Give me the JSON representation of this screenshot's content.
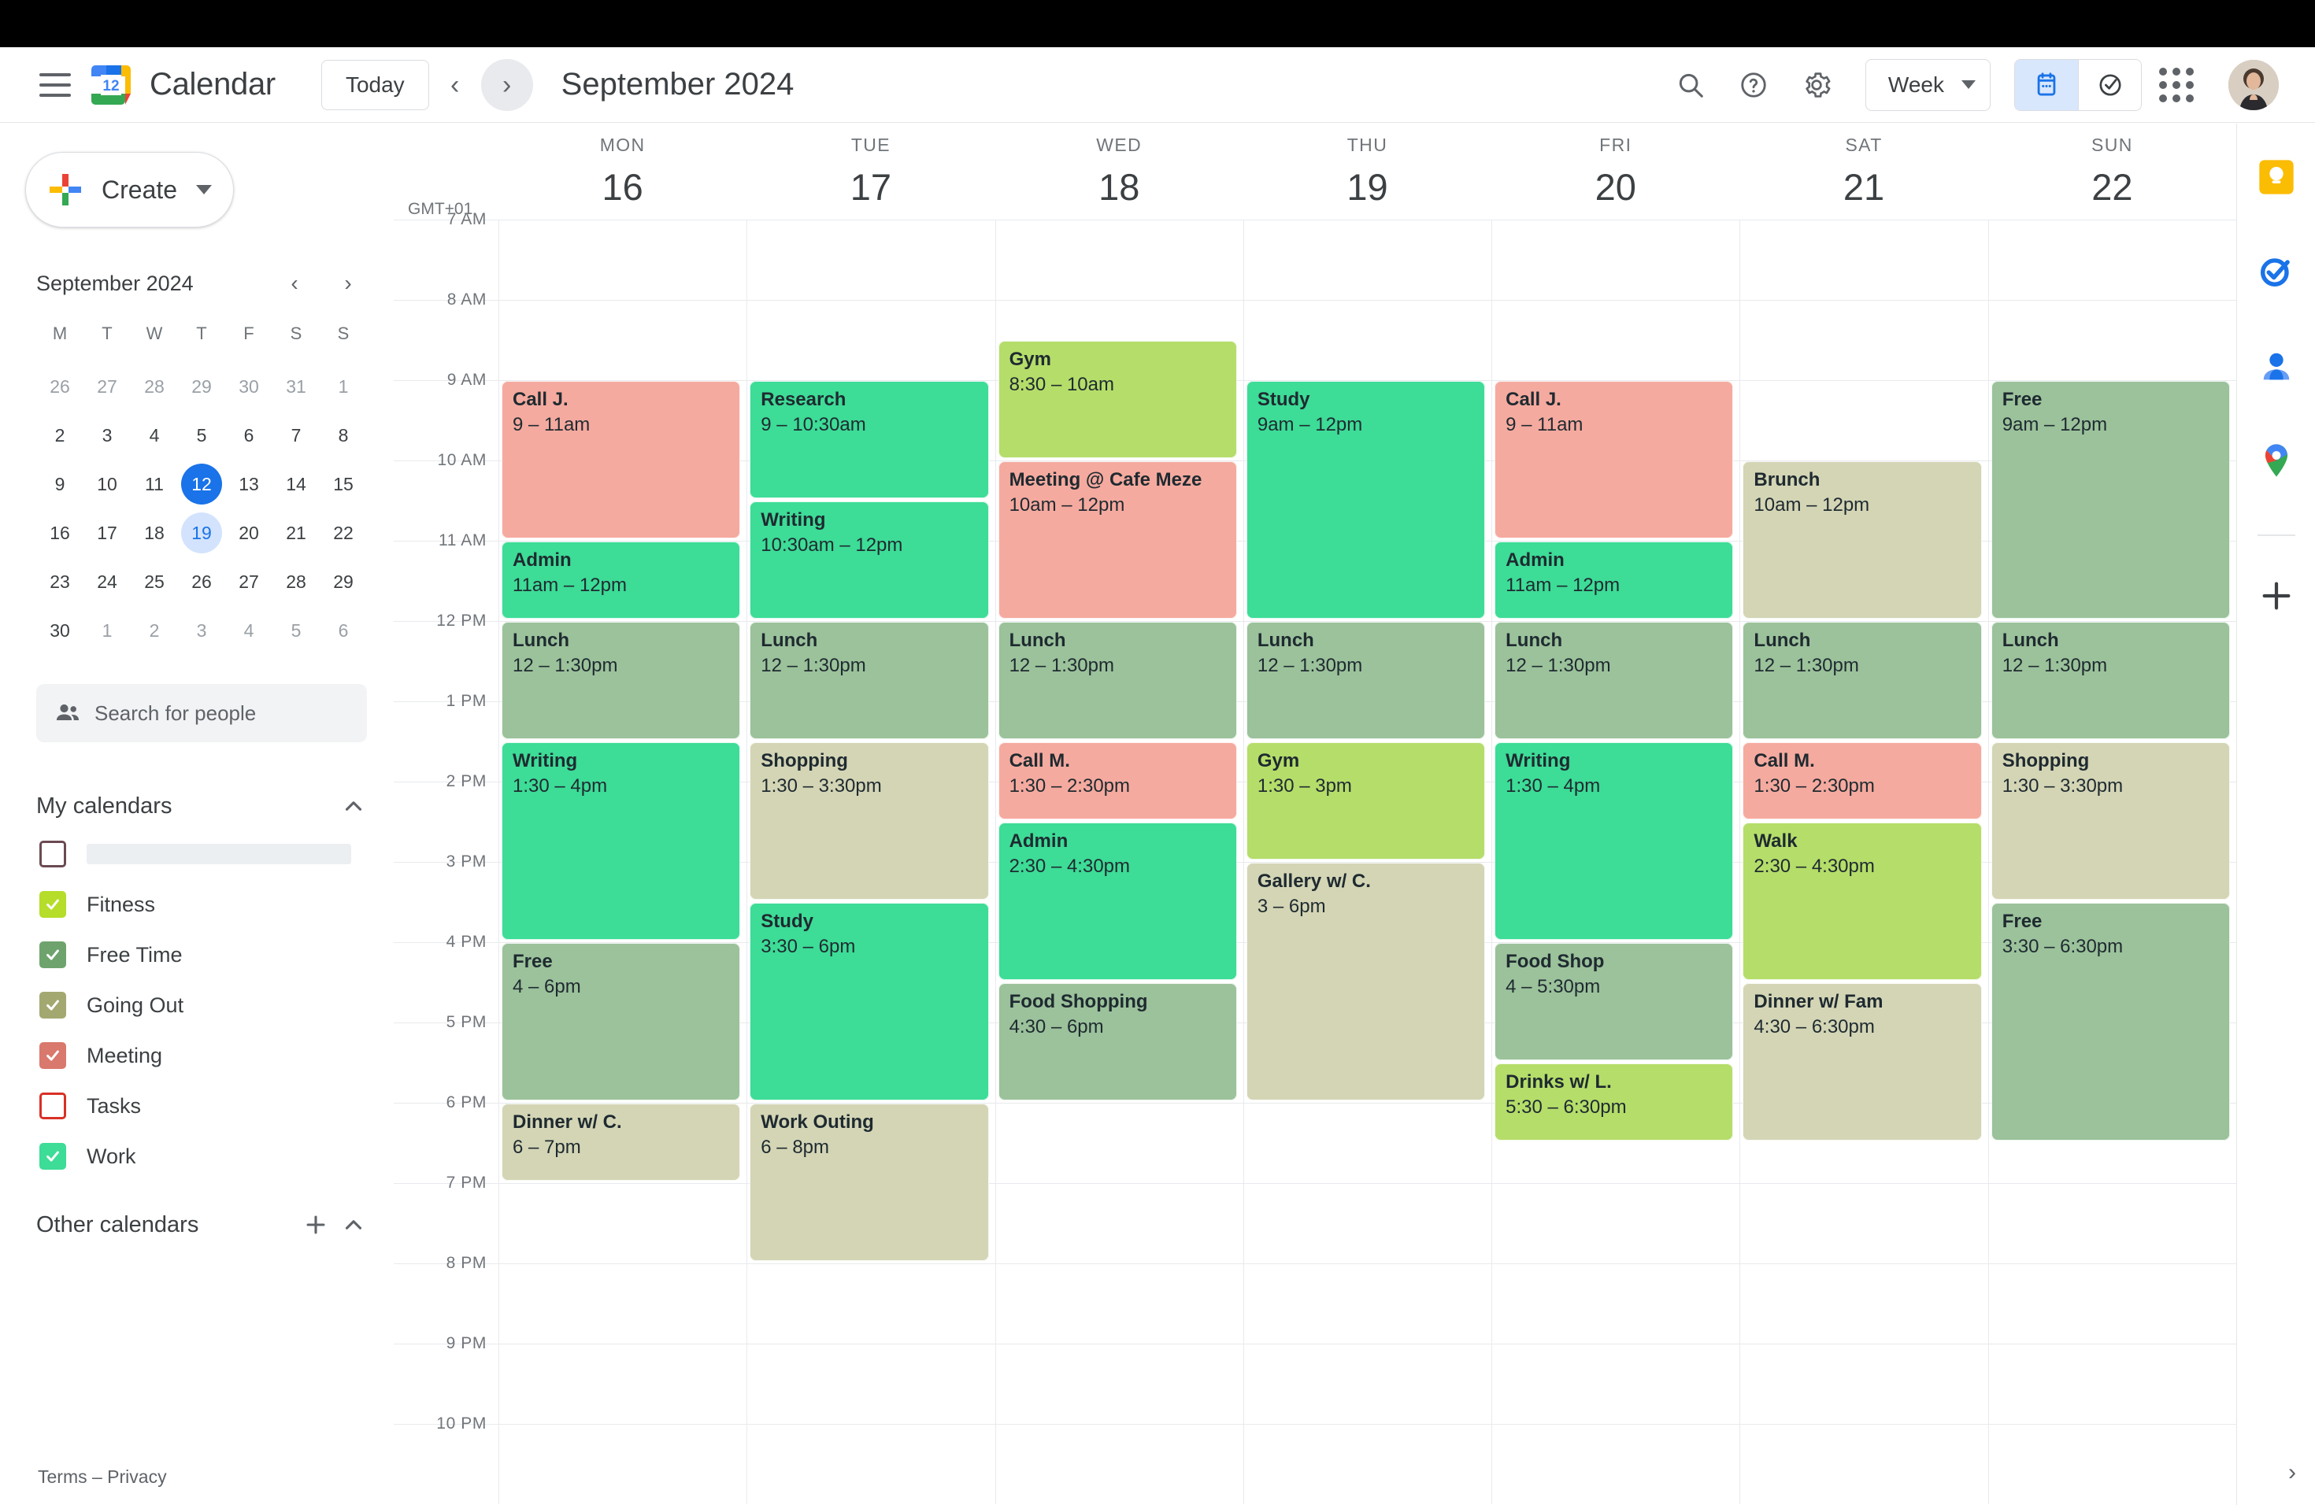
{
  "app": {
    "brand": "Calendar",
    "logo_day": "12"
  },
  "header": {
    "today_label": "Today",
    "month_title": "September 2024",
    "prev_icon": "chevron-left-icon",
    "next_icon": "chevron-right-icon",
    "search_icon": "search-icon",
    "help_icon": "help-icon",
    "settings_icon": "gear-icon",
    "view_label": "Week",
    "calendar_toggle_icon": "calendar-icon",
    "tasks_toggle_icon": "tasks-check-icon",
    "apps_icon": "apps-grid-icon",
    "avatar": "user-avatar"
  },
  "sidebar": {
    "create_label": "Create",
    "mini_calendar": {
      "title": "September 2024",
      "dow": [
        "M",
        "T",
        "W",
        "T",
        "F",
        "S",
        "S"
      ],
      "weeks": [
        [
          {
            "d": "26",
            "m": true
          },
          {
            "d": "27",
            "m": true
          },
          {
            "d": "28",
            "m": true
          },
          {
            "d": "29",
            "m": true
          },
          {
            "d": "30",
            "m": true
          },
          {
            "d": "31",
            "m": true
          },
          {
            "d": "1",
            "m": true
          }
        ],
        [
          {
            "d": "2"
          },
          {
            "d": "3"
          },
          {
            "d": "4"
          },
          {
            "d": "5"
          },
          {
            "d": "6"
          },
          {
            "d": "7"
          },
          {
            "d": "8"
          }
        ],
        [
          {
            "d": "9"
          },
          {
            "d": "10"
          },
          {
            "d": "11"
          },
          {
            "d": "12",
            "today": true
          },
          {
            "d": "13"
          },
          {
            "d": "14"
          },
          {
            "d": "15"
          }
        ],
        [
          {
            "d": "16"
          },
          {
            "d": "17"
          },
          {
            "d": "18"
          },
          {
            "d": "19",
            "sel": true
          },
          {
            "d": "20"
          },
          {
            "d": "21"
          },
          {
            "d": "22"
          }
        ],
        [
          {
            "d": "23"
          },
          {
            "d": "24"
          },
          {
            "d": "25"
          },
          {
            "d": "26"
          },
          {
            "d": "27"
          },
          {
            "d": "28"
          },
          {
            "d": "29"
          }
        ],
        [
          {
            "d": "30"
          },
          {
            "d": "1",
            "m": true
          },
          {
            "d": "2",
            "m": true
          },
          {
            "d": "3",
            "m": true
          },
          {
            "d": "4",
            "m": true
          },
          {
            "d": "5",
            "m": true
          },
          {
            "d": "6",
            "m": true
          }
        ]
      ]
    },
    "search_people_placeholder": "Search for people",
    "my_calendars_label": "My calendars",
    "other_calendars_label": "Other calendars",
    "my_calendars": [
      {
        "label": "",
        "color": "#6b4a52",
        "checked": false,
        "redacted": true
      },
      {
        "label": "Fitness",
        "color": "#b5dd2a",
        "checked": true
      },
      {
        "label": "Free Time",
        "color": "#6ea36e",
        "checked": true
      },
      {
        "label": "Going Out",
        "color": "#a3a871",
        "checked": true
      },
      {
        "label": "Meeting",
        "color": "#d9786c",
        "checked": true
      },
      {
        "label": "Tasks",
        "color": "#d93025",
        "checked": false
      },
      {
        "label": "Work",
        "color": "#3ddc97",
        "checked": true
      }
    ],
    "terms": "Terms – Privacy"
  },
  "grid": {
    "timezone": "GMT+01",
    "hours": [
      "7 AM",
      "8 AM",
      "9 AM",
      "10 AM",
      "11 AM",
      "12 PM",
      "1 PM",
      "2 PM",
      "3 PM",
      "4 PM",
      "5 PM",
      "6 PM",
      "7 PM",
      "8 PM",
      "9 PM",
      "10 PM"
    ],
    "days": [
      {
        "dow": "MON",
        "num": "16"
      },
      {
        "dow": "TUE",
        "num": "17"
      },
      {
        "dow": "WED",
        "num": "18"
      },
      {
        "dow": "THU",
        "num": "19"
      },
      {
        "dow": "FRI",
        "num": "20"
      },
      {
        "dow": "SAT",
        "num": "21"
      },
      {
        "dow": "SUN",
        "num": "22"
      }
    ],
    "colors": {
      "meeting": "#f5aa9f",
      "work": "#3ddc97",
      "free_time": "#9bc29b",
      "going_out": "#d3d5b5",
      "fitness": "#b5dd6a"
    },
    "events": [
      {
        "day": 0,
        "title": "Call J.",
        "time": "9 – 11am",
        "start": 9,
        "end": 11,
        "cal": "meeting"
      },
      {
        "day": 0,
        "title": "Admin",
        "time": "11am – 12pm",
        "start": 11,
        "end": 12,
        "cal": "work"
      },
      {
        "day": 0,
        "title": "Lunch",
        "time": "12 – 1:30pm",
        "start": 12,
        "end": 13.5,
        "cal": "free_time"
      },
      {
        "day": 0,
        "title": "Writing",
        "time": "1:30 – 4pm",
        "start": 13.5,
        "end": 16,
        "cal": "work"
      },
      {
        "day": 0,
        "title": "Free",
        "time": "4 – 6pm",
        "start": 16,
        "end": 18,
        "cal": "free_time"
      },
      {
        "day": 0,
        "title": "Dinner w/ C.",
        "time": "6 – 7pm",
        "start": 18,
        "end": 19,
        "cal": "going_out"
      },
      {
        "day": 1,
        "title": "Research",
        "time": "9 – 10:30am",
        "start": 9,
        "end": 10.5,
        "cal": "work"
      },
      {
        "day": 1,
        "title": "Writing",
        "time": "10:30am – 12pm",
        "start": 10.5,
        "end": 12,
        "cal": "work"
      },
      {
        "day": 1,
        "title": "Lunch",
        "time": "12 – 1:30pm",
        "start": 12,
        "end": 13.5,
        "cal": "free_time"
      },
      {
        "day": 1,
        "title": "Shopping",
        "time": "1:30 – 3:30pm",
        "start": 13.5,
        "end": 15.5,
        "cal": "going_out"
      },
      {
        "day": 1,
        "title": "Study",
        "time": "3:30 – 6pm",
        "start": 15.5,
        "end": 18,
        "cal": "work"
      },
      {
        "day": 1,
        "title": "Work Outing",
        "time": "6 – 8pm",
        "start": 18,
        "end": 20,
        "cal": "going_out"
      },
      {
        "day": 2,
        "title": "Gym",
        "time": "8:30 – 10am",
        "start": 8.5,
        "end": 10,
        "cal": "fitness"
      },
      {
        "day": 2,
        "title": "Meeting @ Cafe Meze",
        "time": "10am – 12pm",
        "start": 10,
        "end": 12,
        "cal": "meeting"
      },
      {
        "day": 2,
        "title": "Lunch",
        "time": "12 – 1:30pm",
        "start": 12,
        "end": 13.5,
        "cal": "free_time"
      },
      {
        "day": 2,
        "title": "Call M.",
        "time": "1:30 – 2:30pm",
        "start": 13.5,
        "end": 14.5,
        "cal": "meeting"
      },
      {
        "day": 2,
        "title": "Admin",
        "time": "2:30 – 4:30pm",
        "start": 14.5,
        "end": 16.5,
        "cal": "work"
      },
      {
        "day": 2,
        "title": "Food Shopping",
        "time": "4:30 – 6pm",
        "start": 16.5,
        "end": 18,
        "cal": "free_time"
      },
      {
        "day": 3,
        "title": "Study",
        "time": "9am – 12pm",
        "start": 9,
        "end": 12,
        "cal": "work"
      },
      {
        "day": 3,
        "title": "Lunch",
        "time": "12 – 1:30pm",
        "start": 12,
        "end": 13.5,
        "cal": "free_time"
      },
      {
        "day": 3,
        "title": "Gym",
        "time": "1:30 – 3pm",
        "start": 13.5,
        "end": 15,
        "cal": "fitness"
      },
      {
        "day": 3,
        "title": "Gallery w/ C.",
        "time": "3 – 6pm",
        "start": 15,
        "end": 18,
        "cal": "going_out"
      },
      {
        "day": 4,
        "title": "Call J.",
        "time": "9 – 11am",
        "start": 9,
        "end": 11,
        "cal": "meeting"
      },
      {
        "day": 4,
        "title": "Admin",
        "time": "11am – 12pm",
        "start": 11,
        "end": 12,
        "cal": "work"
      },
      {
        "day": 4,
        "title": "Lunch",
        "time": "12 – 1:30pm",
        "start": 12,
        "end": 13.5,
        "cal": "free_time"
      },
      {
        "day": 4,
        "title": "Writing",
        "time": "1:30 – 4pm",
        "start": 13.5,
        "end": 16,
        "cal": "work"
      },
      {
        "day": 4,
        "title": "Food Shop",
        "time": "4 – 5:30pm",
        "start": 16,
        "end": 17.5,
        "cal": "free_time"
      },
      {
        "day": 4,
        "title": "Drinks w/ L.",
        "time": "5:30 – 6:30pm",
        "start": 17.5,
        "end": 18.5,
        "cal": "fitness"
      },
      {
        "day": 5,
        "title": "Brunch",
        "time": "10am – 12pm",
        "start": 10,
        "end": 12,
        "cal": "going_out"
      },
      {
        "day": 5,
        "title": "Lunch",
        "time": "12 – 1:30pm",
        "start": 12,
        "end": 13.5,
        "cal": "free_time"
      },
      {
        "day": 5,
        "title": "Call M.",
        "time": "1:30 – 2:30pm",
        "start": 13.5,
        "end": 14.5,
        "cal": "meeting"
      },
      {
        "day": 5,
        "title": "Walk",
        "time": "2:30 – 4:30pm",
        "start": 14.5,
        "end": 16.5,
        "cal": "fitness"
      },
      {
        "day": 5,
        "title": "Dinner w/ Fam",
        "time": "4:30 – 6:30pm",
        "start": 16.5,
        "end": 18.5,
        "cal": "going_out"
      },
      {
        "day": 6,
        "title": "Free",
        "time": "9am – 12pm",
        "start": 9,
        "end": 12,
        "cal": "free_time"
      },
      {
        "day": 6,
        "title": "Lunch",
        "time": "12 – 1:30pm",
        "start": 12,
        "end": 13.5,
        "cal": "free_time"
      },
      {
        "day": 6,
        "title": "Shopping",
        "time": "1:30 – 3:30pm",
        "start": 13.5,
        "end": 15.5,
        "cal": "going_out"
      },
      {
        "day": 6,
        "title": "Free",
        "time": "3:30 – 6:30pm",
        "start": 15.5,
        "end": 18.5,
        "cal": "free_time"
      }
    ]
  },
  "rail": {
    "items": [
      {
        "icon": "keep-icon"
      },
      {
        "icon": "tasks-icon"
      },
      {
        "icon": "contacts-icon"
      },
      {
        "icon": "maps-icon"
      }
    ],
    "add_label": "+",
    "expand_icon": "chevron-right-icon"
  }
}
